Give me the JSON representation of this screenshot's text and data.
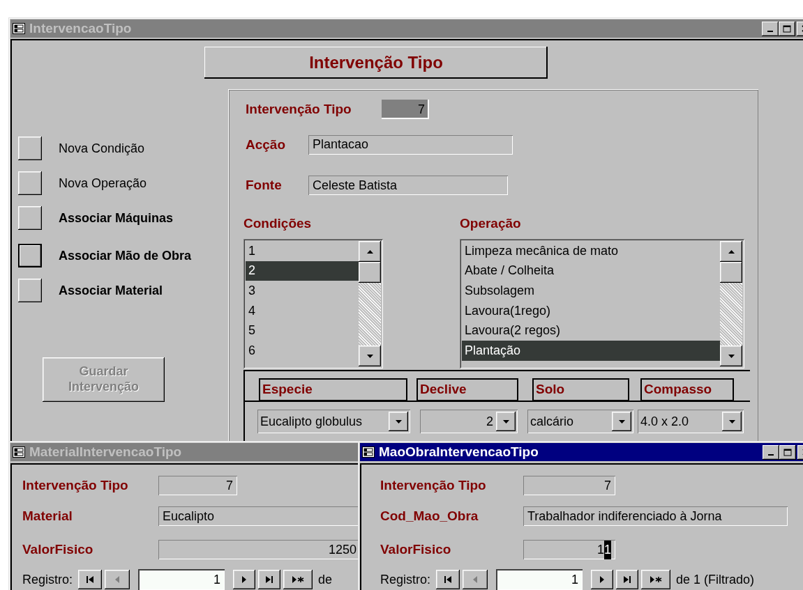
{
  "main_window": {
    "title": "IntervencaoTipo",
    "active": false,
    "header": "Intervenção Tipo",
    "actions": [
      {
        "label": "Nova Condição",
        "bold": false,
        "focused": false
      },
      {
        "label": "Nova Operação",
        "bold": false,
        "focused": false
      },
      {
        "label": "Associar Máquinas",
        "bold": true,
        "focused": false
      },
      {
        "label": "Associar Mão de Obra",
        "bold": true,
        "focused": true
      },
      {
        "label": "Associar Material",
        "bold": true,
        "focused": false
      }
    ],
    "save_button": {
      "label": "Guardar Intervenção",
      "disabled": true
    },
    "fields": [
      {
        "label": "Intervenção Tipo",
        "value": "7",
        "kind": "id"
      },
      {
        "label": "Acção",
        "value": "Plantacao",
        "kind": "text"
      },
      {
        "label": "Fonte",
        "value": "Celeste Batista",
        "kind": "text"
      }
    ],
    "conditions": {
      "label": "Condições",
      "items": [
        {
          "text": "1",
          "selected": false
        },
        {
          "text": "2",
          "selected": true
        },
        {
          "text": "3",
          "selected": false
        },
        {
          "text": "4",
          "selected": false
        },
        {
          "text": "5",
          "selected": false
        },
        {
          "text": "6",
          "selected": false
        }
      ]
    },
    "operations": {
      "label": "Operação",
      "items": [
        {
          "text": "Limpeza mecânica de mato",
          "selected": false
        },
        {
          "text": "Abate / Colheita",
          "selected": false
        },
        {
          "text": "Subsolagem",
          "selected": false
        },
        {
          "text": "Lavoura(1rego)",
          "selected": false
        },
        {
          "text": "Lavoura(2 regos)",
          "selected": false
        },
        {
          "text": "Plantação",
          "selected": true
        }
      ]
    },
    "subform": {
      "columns": [
        "Especie",
        "Declive",
        "Solo",
        "Compasso"
      ],
      "values": [
        {
          "value": "Eucalipto globulus",
          "kind": "text"
        },
        {
          "value": "2",
          "kind": "number"
        },
        {
          "value": "calcário",
          "kind": "text"
        },
        {
          "value": "4.0 x 2.0",
          "kind": "text"
        }
      ]
    }
  },
  "material_window": {
    "title": "MaterialIntervencaoTipo",
    "active": false,
    "fields": [
      {
        "label": "Intervenção Tipo",
        "value": "7",
        "kind": "number"
      },
      {
        "label": "Material",
        "value": "Eucalipto",
        "kind": "text"
      },
      {
        "label": "ValorFisico",
        "value": "1250",
        "kind": "number"
      }
    ],
    "nav": {
      "label": "Registro:",
      "current": "1",
      "total": "de"
    }
  },
  "mao_obra_window": {
    "title": "MaoObraIntervencaoTipo",
    "active": true,
    "fields": [
      {
        "label": "Intervenção Tipo",
        "value": "7",
        "kind": "number",
        "highlight_last": false
      },
      {
        "label": "Cod_Mao_Obra",
        "value": "Trabalhador indiferenciado à Jorna",
        "kind": "text",
        "highlight_last": false
      },
      {
        "label": "ValorFisico",
        "value": "11",
        "kind": "number",
        "highlight_last": true
      }
    ],
    "nav": {
      "label": "Registro:",
      "current": "1",
      "total": "de  1 (Filtrado)"
    }
  }
}
